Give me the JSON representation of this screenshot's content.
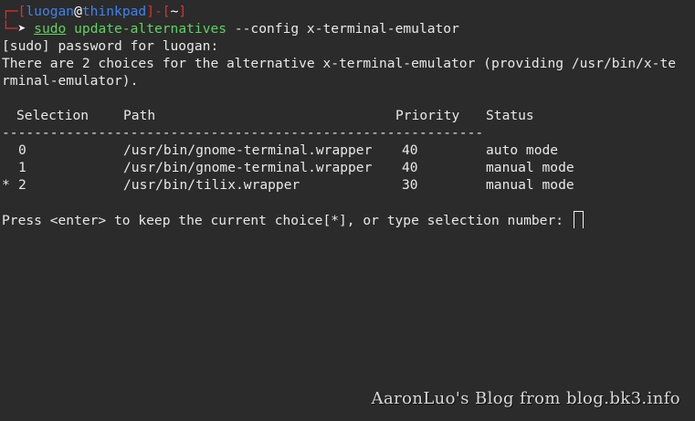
{
  "prompt": {
    "user": "luogan",
    "at": "@",
    "host": "thinkpad",
    "dir": "~",
    "bracket_open": "[",
    "bracket_close": "]",
    "dash": "-",
    "corner_top": "┌─",
    "corner_bottom": "└─",
    "arrow": "➤"
  },
  "command": {
    "sudo": "sudo",
    "program": "update-alternatives",
    "args": "--config x-terminal-emulator"
  },
  "output": {
    "password_line": "[sudo] password for luogan:",
    "choices_line_1": "There are 2 choices for the alternative x-terminal-emulator (providing /usr/bin/x-te",
    "choices_line_2": "rminal-emulator).",
    "headers": {
      "selection": "Selection",
      "path": "Path",
      "priority": "Priority",
      "status": "Status"
    },
    "separator": "------------------------------------------------------------",
    "rows": [
      {
        "marker": " ",
        "selection": "0",
        "path": "/usr/bin/gnome-terminal.wrapper",
        "priority": "40",
        "status": "auto mode"
      },
      {
        "marker": " ",
        "selection": "1",
        "path": "/usr/bin/gnome-terminal.wrapper",
        "priority": "40",
        "status": "manual mode"
      },
      {
        "marker": "*",
        "selection": "2",
        "path": "/usr/bin/tilix.wrapper",
        "priority": "30",
        "status": "manual mode"
      }
    ],
    "input_prompt": "Press <enter> to keep the current choice[*], or type selection number:"
  },
  "watermark": "AaronLuo's Blog from blog.bk3.info",
  "colors": {
    "background": "#2b2b2b",
    "foreground": "#e8e8e8",
    "prompt_red": "#e0302f",
    "prompt_blue": "#3f83ee",
    "command_green": "#5fd35f"
  }
}
